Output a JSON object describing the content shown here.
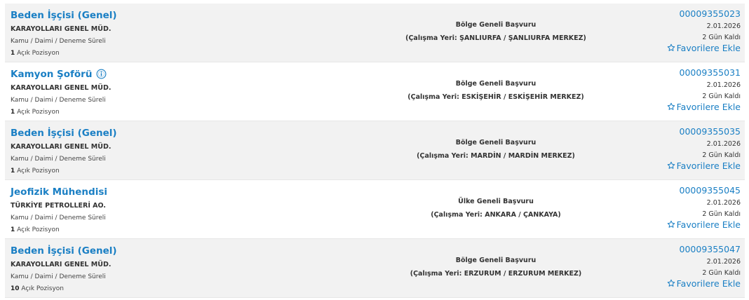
{
  "colors": {
    "link": "#1a7fc4",
    "text": "#333333",
    "row_alt": "#f2f2f2"
  },
  "icons": {
    "favorite": "star-outline-icon",
    "info": "info-badge-icon"
  },
  "jobs": [
    {
      "title": "Beden İşçisi (Genel)",
      "has_info_icon": false,
      "organization": "KARAYOLLARI GENEL MÜD.",
      "employment": "Kamu / Daimi / Deneme Süreli",
      "positions_count": "1",
      "positions_label": "Açık Pozisyon",
      "scope": "Bölge Geneli Başvuru",
      "location": "(Çalışma Yeri: ŞANLIURFA / ŞANLIURFA MERKEZ)",
      "code": "00009355023",
      "date": "2.01.2026",
      "days_left": "2 Gün Kaldı",
      "favorite_label": "Favorilere Ekle"
    },
    {
      "title": "Kamyon Şoförü",
      "has_info_icon": true,
      "organization": "KARAYOLLARI GENEL MÜD.",
      "employment": "Kamu / Daimi / Deneme Süreli",
      "positions_count": "1",
      "positions_label": "Açık Pozisyon",
      "scope": "Bölge Geneli Başvuru",
      "location": "(Çalışma Yeri: ESKİŞEHİR / ESKİŞEHİR MERKEZ)",
      "code": "00009355031",
      "date": "2.01.2026",
      "days_left": "2 Gün Kaldı",
      "favorite_label": "Favorilere Ekle"
    },
    {
      "title": "Beden İşçisi (Genel)",
      "has_info_icon": false,
      "organization": "KARAYOLLARI GENEL MÜD.",
      "employment": "Kamu / Daimi / Deneme Süreli",
      "positions_count": "1",
      "positions_label": "Açık Pozisyon",
      "scope": "Bölge Geneli Başvuru",
      "location": "(Çalışma Yeri: MARDİN / MARDİN MERKEZ)",
      "code": "00009355035",
      "date": "2.01.2026",
      "days_left": "2 Gün Kaldı",
      "favorite_label": "Favorilere Ekle"
    },
    {
      "title": "Jeofizik Mühendisi",
      "has_info_icon": false,
      "organization": "TÜRKİYE PETROLLERİ AO.",
      "employment": "Kamu / Daimi / Deneme Süreli",
      "positions_count": "1",
      "positions_label": "Açık Pozisyon",
      "scope": "Ülke Geneli Başvuru",
      "location": "(Çalışma Yeri: ANKARA / ÇANKAYA)",
      "code": "00009355045",
      "date": "2.01.2026",
      "days_left": "2 Gün Kaldı",
      "favorite_label": "Favorilere Ekle"
    },
    {
      "title": "Beden İşçisi (Genel)",
      "has_info_icon": false,
      "organization": "KARAYOLLARI GENEL MÜD.",
      "employment": "Kamu / Daimi / Deneme Süreli",
      "positions_count": "10",
      "positions_label": "Açık Pozisyon",
      "scope": "Bölge Geneli Başvuru",
      "location": "(Çalışma Yeri: ERZURUM / ERZURUM MERKEZ)",
      "code": "00009355047",
      "date": "2.01.2026",
      "days_left": "2 Gün Kaldı",
      "favorite_label": "Favorilere Ekle"
    }
  ]
}
